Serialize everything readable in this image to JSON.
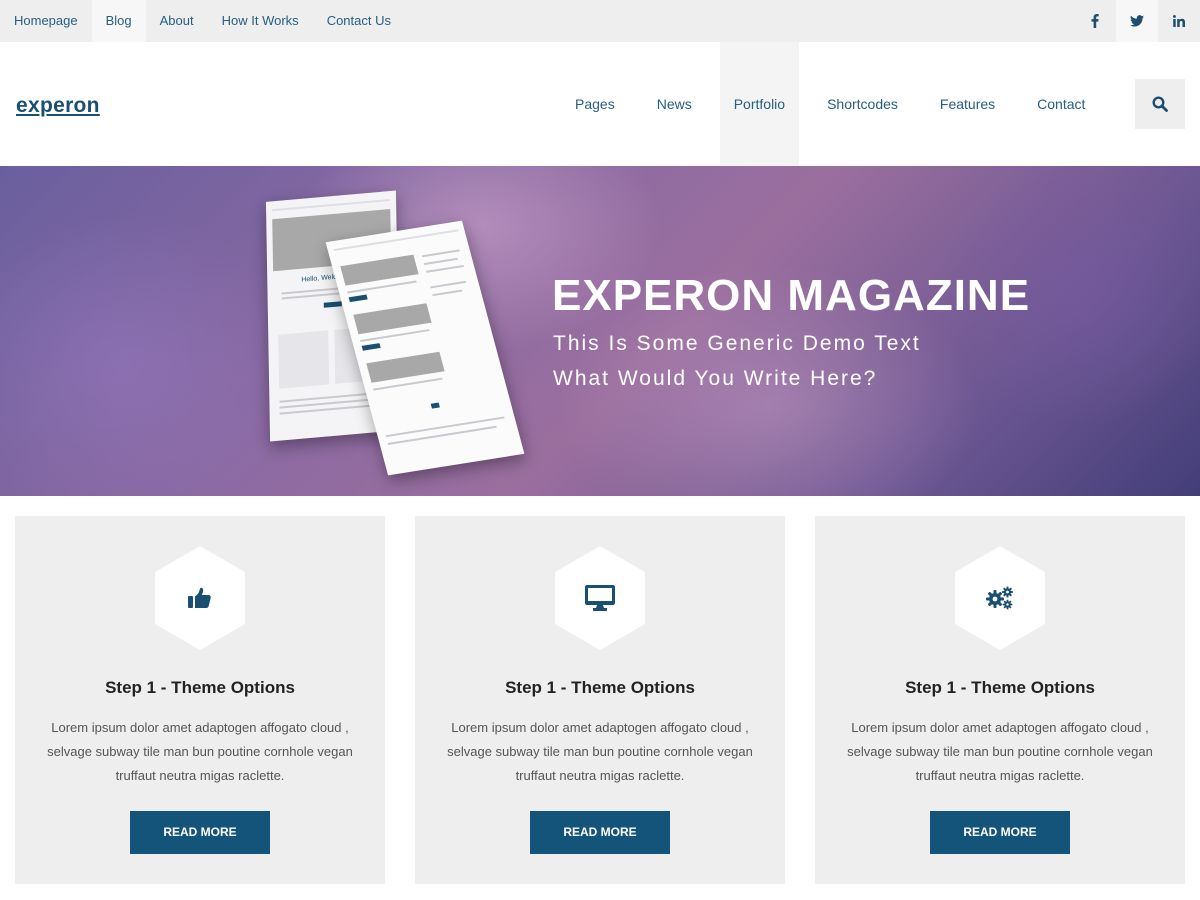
{
  "topbar": {
    "links": [
      "Homepage",
      "Blog",
      "About",
      "How It Works",
      "Contact Us"
    ],
    "social": [
      "facebook-icon",
      "twitter-icon",
      "linkedin-icon"
    ]
  },
  "header": {
    "logo": "experon",
    "nav": [
      "Pages",
      "News",
      "Portfolio",
      "Shortcodes",
      "Features",
      "Contact"
    ],
    "search_icon": "search-icon"
  },
  "hero": {
    "title": "EXPERON MAGAZINE",
    "subtitle_line1": "This Is Some Generic Demo Text",
    "subtitle_line2": "What Would You Write Here?",
    "mockup_heading": "Hello, Welcome To"
  },
  "cards": [
    {
      "icon": "thumbs-up-icon",
      "title": "Step 1 - Theme Options",
      "text": "Lorem ipsum dolor amet adaptogen affogato cloud , selvage subway tile man bun poutine cornhole vegan truffaut neutra migas raclette.",
      "button": "READ MORE"
    },
    {
      "icon": "desktop-icon",
      "title": "Step 1 - Theme Options",
      "text": "Lorem ipsum dolor amet adaptogen affogato cloud , selvage subway tile man bun poutine cornhole vegan truffaut neutra migas raclette.",
      "button": "READ MORE"
    },
    {
      "icon": "gears-icon",
      "title": "Step 1 - Theme Options",
      "text": "Lorem ipsum dolor amet adaptogen affogato cloud , selvage subway tile man bun poutine cornhole vegan truffaut neutra migas raclette.",
      "button": "READ MORE"
    }
  ],
  "colors": {
    "brand": "#1b4f72",
    "button": "#15547a",
    "topbar_bg": "#eeeeee",
    "card_bg": "#eeeeee"
  }
}
